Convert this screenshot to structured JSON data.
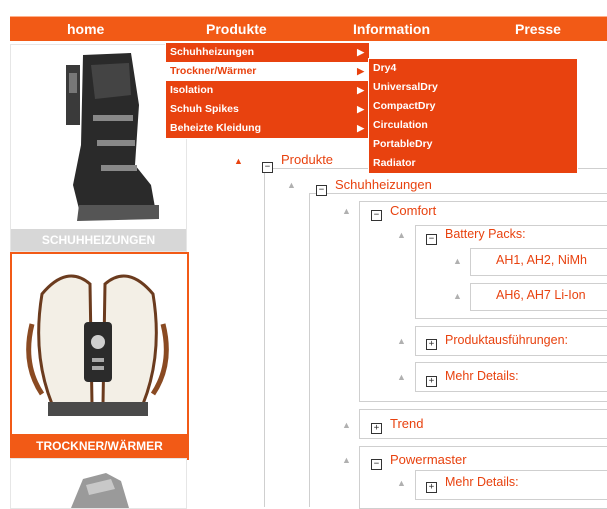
{
  "nav": {
    "items": [
      "home",
      "Produkte",
      "Information",
      "Presse"
    ]
  },
  "menu_level1": {
    "items": [
      {
        "label": "Schuhheizungen",
        "has_submenu": true
      },
      {
        "label": "Trockner/Wärmer",
        "has_submenu": true,
        "active": true
      },
      {
        "label": "Isolation",
        "has_submenu": true
      },
      {
        "label": "Schuh Spikes",
        "has_submenu": true
      },
      {
        "label": "Beheizte Kleidung",
        "has_submenu": true
      }
    ]
  },
  "menu_level2": {
    "items": [
      "Dry4",
      "UniversalDry",
      "CompactDry",
      "Circulation",
      "PortableDry",
      "Radiator"
    ]
  },
  "sidebar": {
    "tiles": [
      {
        "label": "SCHUHHEIZUNGEN"
      },
      {
        "label": "TROCKNER/WÄRMER"
      }
    ]
  },
  "tree": {
    "root": "Produkte",
    "schuhheizungen": "Schuhheizungen",
    "comfort": "Comfort",
    "battery_packs": "Battery Packs:",
    "ah1": "AH1, AH2, NiMh",
    "ah6": "AH6, AH7 Li-Ion",
    "produktausfuehrungen": "Produktausführungen:",
    "mehr_details_1": "Mehr Details:",
    "trend": "Trend",
    "powermaster": "Powermaster",
    "mehr_details_2": "Mehr Details:"
  },
  "colors": {
    "accent": "#f25a16",
    "menu_bg": "#e8420f",
    "tree_text": "#e8420f"
  }
}
